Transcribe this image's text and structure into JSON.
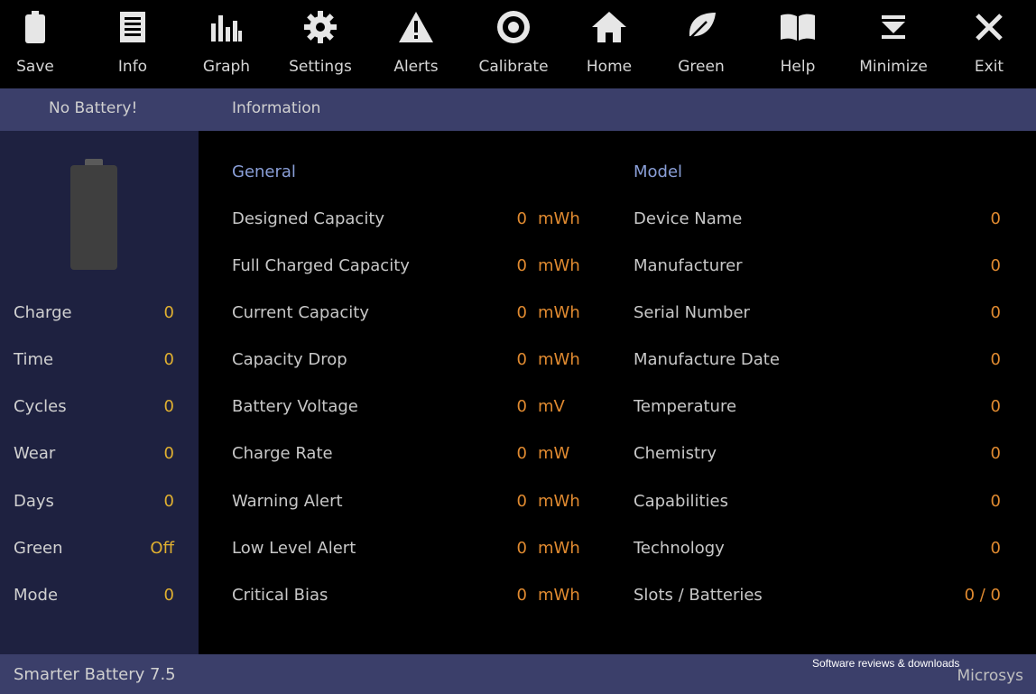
{
  "toolbar": {
    "buttons": [
      {
        "label": "Save",
        "icon": "battery-icon"
      },
      {
        "label": "Info",
        "icon": "document-icon"
      },
      {
        "label": "Graph",
        "icon": "bar-graph-icon"
      },
      {
        "label": "Settings",
        "icon": "gear-icon"
      },
      {
        "label": "Alerts",
        "icon": "warning-icon"
      },
      {
        "label": "Calibrate",
        "icon": "target-icon"
      },
      {
        "label": "Home",
        "icon": "home-icon"
      },
      {
        "label": "Green",
        "icon": "leaf-icon"
      },
      {
        "label": "Help",
        "icon": "book-icon"
      },
      {
        "label": "Minimize",
        "icon": "minimize-icon"
      },
      {
        "label": "Exit",
        "icon": "close-icon"
      }
    ]
  },
  "header": {
    "status": "No Battery!",
    "title": "Information"
  },
  "sidebar": {
    "rows": [
      {
        "label": "Charge",
        "value": "0"
      },
      {
        "label": "Time",
        "value": "0"
      },
      {
        "label": "Cycles",
        "value": "0"
      },
      {
        "label": "Wear",
        "value": "0"
      },
      {
        "label": "Days",
        "value": "0"
      },
      {
        "label": "Green",
        "value": "Off"
      },
      {
        "label": "Mode",
        "value": "0"
      }
    ]
  },
  "general": {
    "title": "General",
    "rows": [
      {
        "label": "Designed Capacity",
        "value": "0",
        "unit": "mWh"
      },
      {
        "label": "Full Charged Capacity",
        "value": "0",
        "unit": "mWh"
      },
      {
        "label": "Current Capacity",
        "value": "0",
        "unit": "mWh"
      },
      {
        "label": "Capacity Drop",
        "value": "0",
        "unit": "mWh"
      },
      {
        "label": "Battery Voltage",
        "value": "0",
        "unit": "mV"
      },
      {
        "label": "Charge Rate",
        "value": "0",
        "unit": "mW"
      },
      {
        "label": "Warning Alert",
        "value": "0",
        "unit": "mWh"
      },
      {
        "label": "Low Level Alert",
        "value": "0",
        "unit": "mWh"
      },
      {
        "label": "Critical Bias",
        "value": "0",
        "unit": "mWh"
      }
    ]
  },
  "model": {
    "title": "Model",
    "rows": [
      {
        "label": "Device Name",
        "value": "0"
      },
      {
        "label": "Manufacturer",
        "value": "0"
      },
      {
        "label": "Serial Number",
        "value": "0"
      },
      {
        "label": "Manufacture Date",
        "value": "0"
      },
      {
        "label": "Temperature",
        "value": "0"
      },
      {
        "label": "Chemistry",
        "value": "0"
      },
      {
        "label": "Capabilities",
        "value": "0"
      },
      {
        "label": "Technology",
        "value": "0"
      },
      {
        "label": "Slots / Batteries",
        "value": "0 / 0"
      }
    ]
  },
  "footer": {
    "app_name": "Smarter Battery 7.5",
    "company": "Microsys"
  },
  "watermark": {
    "tagline": "Software reviews & downloads"
  },
  "colors": {
    "header_bg": "#3b3f6a",
    "sidebar_bg": "#1e2140",
    "value": "#e08a30",
    "sidebar_value": "#e0b030",
    "section_title": "#8a9fd8"
  }
}
